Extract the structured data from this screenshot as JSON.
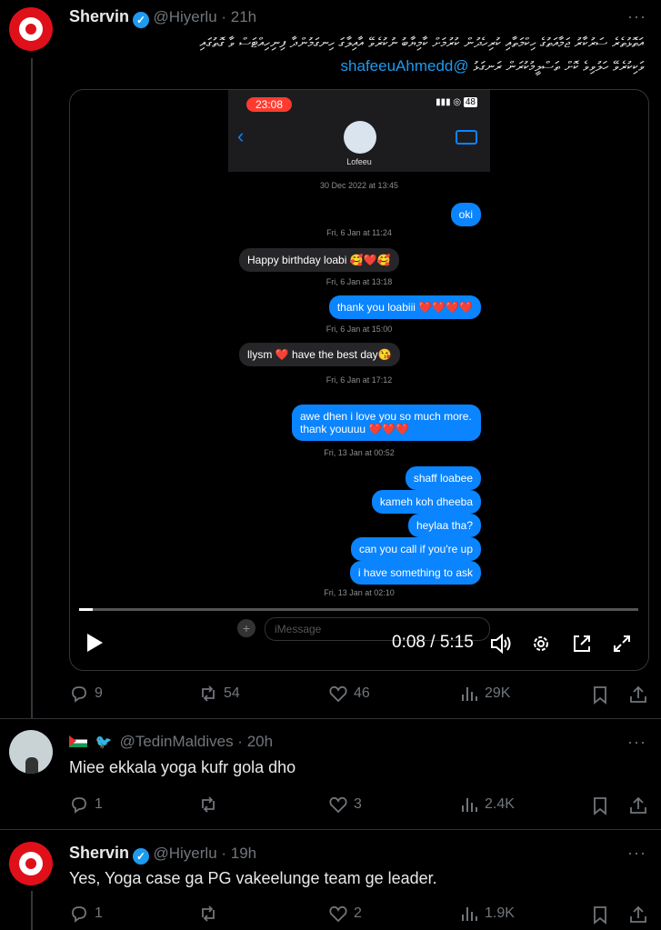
{
  "tweet1": {
    "name": "Shervin",
    "handle": "@Hiyerlu",
    "time": "21h",
    "more": "···",
    "text_line1": "އަތޮޅުތެރެ ސަރުކާރު ޖަމާއަތުގެ ހިކްމަތާއި ކުރިހެދުން ކުރުމަށް ކާމިޔާބު ނުކުރެވޭ އާއިލާގަ ހިނގަމުންދާ ފިނިހިއްޓަސް ވާ ގޮތުގައި",
    "text_line2": "ވަކިކުރެވޭ ހަލުވިވެ ކޮށް ތަސްލީމުކުރަން ރަނގަޅު",
    "mention": "@shafeeuAhmedd",
    "stats": {
      "replies": "9",
      "retweets": "54",
      "likes": "46",
      "views": "29K"
    }
  },
  "video": {
    "time_display": "0:08 / 5:15",
    "progress": 0.025,
    "phone": {
      "clock": "23:08",
      "battery": "48",
      "contact": "Lofeeu",
      "input_placeholder": "iMessage"
    },
    "messages": [
      {
        "type": "ts",
        "text": "30 Dec 2022 at 13:45"
      },
      {
        "type": "out",
        "text": "oki"
      },
      {
        "type": "ts",
        "text": "Fri, 6 Jan at 11:24"
      },
      {
        "type": "in",
        "text": "Happy birthday loabi 🥰❤️🥰"
      },
      {
        "type": "ts",
        "text": "Fri, 6 Jan at 13:18"
      },
      {
        "type": "out",
        "text": "thank you loabiii ❤️❤️❤️❤️"
      },
      {
        "type": "ts",
        "text": "Fri, 6 Jan at 15:00"
      },
      {
        "type": "in",
        "text": "llysm ❤️ have the best day😘"
      },
      {
        "type": "ts",
        "text": "Fri, 6 Jan at 17:12"
      },
      {
        "type": "out",
        "text": "awe dhen i love you so much more. thank youuuu ❤️❤️❤️"
      },
      {
        "type": "ts",
        "text": "Fri, 13 Jan at 00:52"
      },
      {
        "type": "out",
        "text": "shaff loabee"
      },
      {
        "type": "out",
        "text": "kameh koh dheeba"
      },
      {
        "type": "out",
        "text": "heylaa tha?"
      },
      {
        "type": "out",
        "text": "can you call if you're up"
      },
      {
        "type": "out",
        "text": "i have something to ask"
      },
      {
        "type": "ts",
        "text": "Fri, 13 Jan at 02:10"
      }
    ]
  },
  "reply1": {
    "handle": "@TedinMaldives",
    "time": "20h",
    "text": "Miee ekkala yoga kufr gola dho",
    "stats": {
      "replies": "1",
      "retweets": "",
      "likes": "3",
      "views": "2.4K"
    }
  },
  "reply2": {
    "name": "Shervin",
    "handle": "@Hiyerlu",
    "time": "19h",
    "text": "Yes, Yoga case ga PG vakeelunge team ge leader.",
    "stats": {
      "replies": "1",
      "retweets": "",
      "likes": "2",
      "views": "1.9K"
    }
  },
  "colors": {
    "accent": "#1d9bf0",
    "imessage_blue": "#0a84ff",
    "avatar_red": "#e0101a"
  }
}
